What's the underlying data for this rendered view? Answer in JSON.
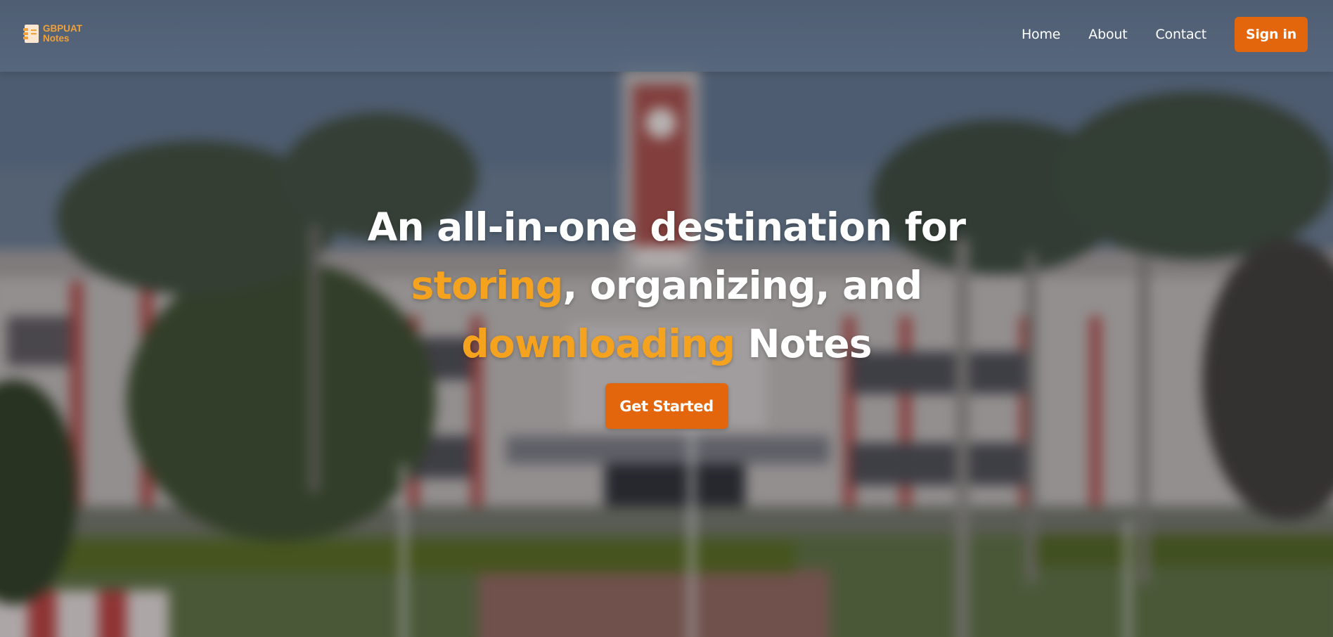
{
  "brand": {
    "line1": "GBPUAT",
    "line2": "Notes",
    "icon": "notebook-icon"
  },
  "nav": {
    "links": [
      "Home",
      "About",
      "Contact"
    ],
    "signin_label": "Sign in"
  },
  "hero": {
    "line1": "An all-in-one destination for",
    "accent1": "storing",
    "line2_rest": ", organizing, and",
    "accent2": "downloading",
    "line3_rest": " Notes",
    "cta_label": "Get Started"
  },
  "colors": {
    "accent": "#f5a21f",
    "button": "#e3650c",
    "text": "#ffffff"
  }
}
